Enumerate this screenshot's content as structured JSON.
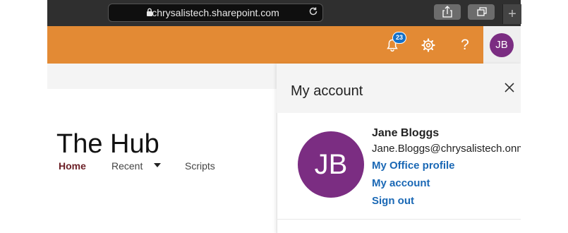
{
  "browser": {
    "url": "chrysalistech.sharepoint.com",
    "newtab_label": "+"
  },
  "suitebar": {
    "notification_count": "23",
    "help_label": "?",
    "user_initials": "JB",
    "colors": {
      "bar": "#e38a34",
      "badge": "#1470c8",
      "avatar": "#7b2d82"
    }
  },
  "site": {
    "title": "The Hub",
    "nav": {
      "home": "Home",
      "recent": "Recent",
      "scripts": "Scripts"
    }
  },
  "account_panel": {
    "title": "My account",
    "initials": "JB",
    "name": "Jane Bloggs",
    "email": "Jane.Bloggs@chrysalistech.onm",
    "links": {
      "office_profile": "My Office profile",
      "my_account": "My account",
      "sign_out": "Sign out"
    }
  }
}
